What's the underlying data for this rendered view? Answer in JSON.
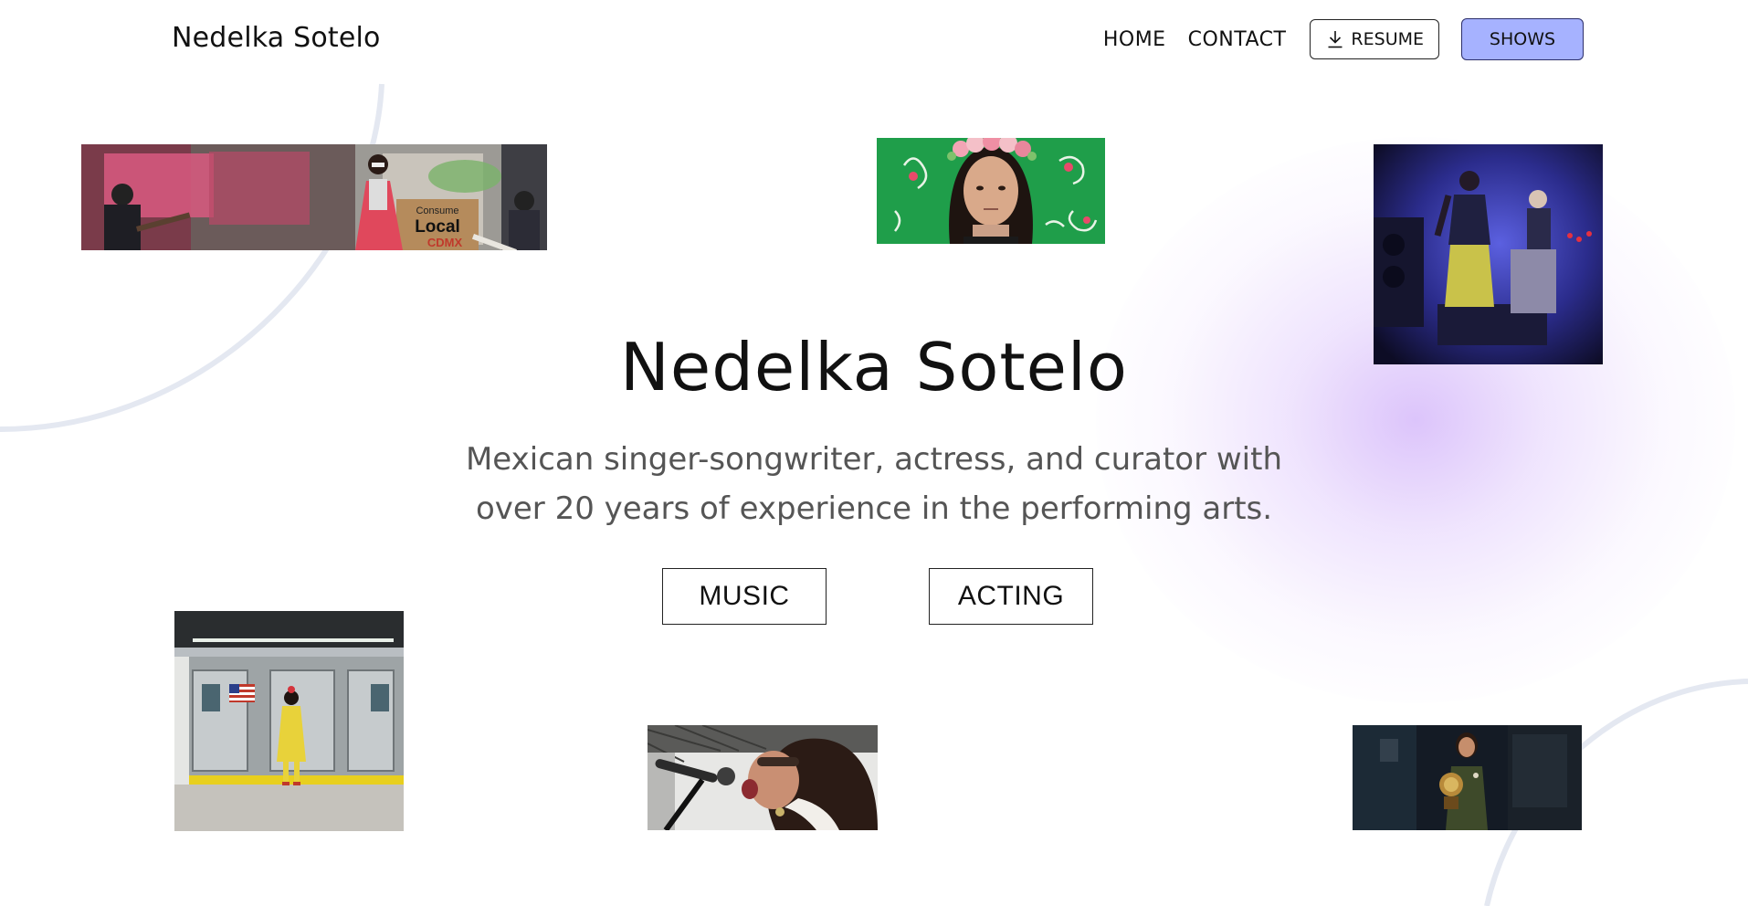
{
  "header": {
    "logo_text": "Nedelka Sotelo",
    "nav": {
      "home_label": "HOME",
      "contact_label": "CONTACT",
      "resume_label": "RESUME",
      "shows_label": "SHOWS"
    }
  },
  "hero": {
    "title": "Nedelka Sotelo",
    "subtitle_line1": "Mexican singer-songwriter, actress, and curator with",
    "subtitle_line2": "over 20 years of experience in the performing arts.",
    "music_label": "MUSIC",
    "acting_label": "ACTING"
  },
  "photos": {
    "banner_sign_line1": "Consume",
    "banner_sign_line2": "Local",
    "banner_sign_line3": "CDMX"
  },
  "icons": {
    "resume_icon": "download-icon"
  },
  "colors": {
    "shows_button_bg": "#a6b2ff",
    "glow": "#d6bafa",
    "arc": "#e4e8f1",
    "text_primary": "#111111",
    "text_secondary": "#555555"
  }
}
